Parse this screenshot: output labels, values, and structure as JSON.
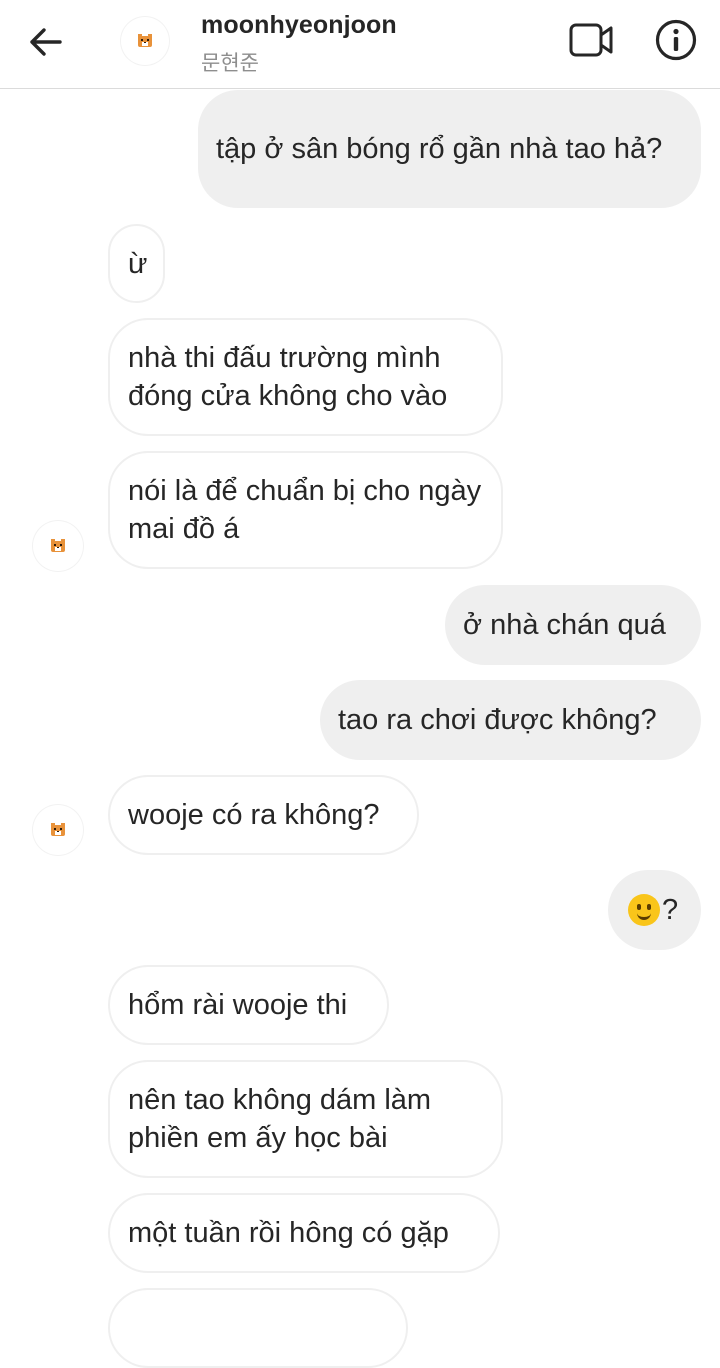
{
  "header": {
    "username": "moonhyeonjoon",
    "display_name": "문현준"
  },
  "messages": [
    {
      "side": "out",
      "text": "tập ở sân bóng rổ gần nhà tao hả?"
    },
    {
      "side": "in",
      "text": "ừ"
    },
    {
      "side": "in",
      "text": "nhà thi đấu trường mình đóng cửa không cho vào"
    },
    {
      "side": "in",
      "text": "nói là để chuẩn bị cho ngày mai đồ á"
    },
    {
      "side": "out",
      "text": "ở nhà chán quá"
    },
    {
      "side": "out",
      "text": "tao ra chơi được không?"
    },
    {
      "side": "in",
      "text": "wooje có ra không?"
    },
    {
      "side": "out",
      "emoji": "slightly-smiling-face-emoji",
      "text": "?"
    },
    {
      "side": "in",
      "text": "hổm rài wooje thi"
    },
    {
      "side": "in",
      "text": "nên tao không dám làm phiền em ấy học bài"
    },
    {
      "side": "in",
      "text": "một tuần rồi hông có gặp"
    }
  ],
  "icons": {
    "back": "arrow-left-icon",
    "video": "video-call-icon",
    "info": "info-icon",
    "avatar": "tiger-avatar"
  },
  "colors": {
    "incoming_bubble_border": "#efefef",
    "outgoing_bubble": "#efefef",
    "text": "#262626",
    "subtitle": "#8e8e8e"
  }
}
